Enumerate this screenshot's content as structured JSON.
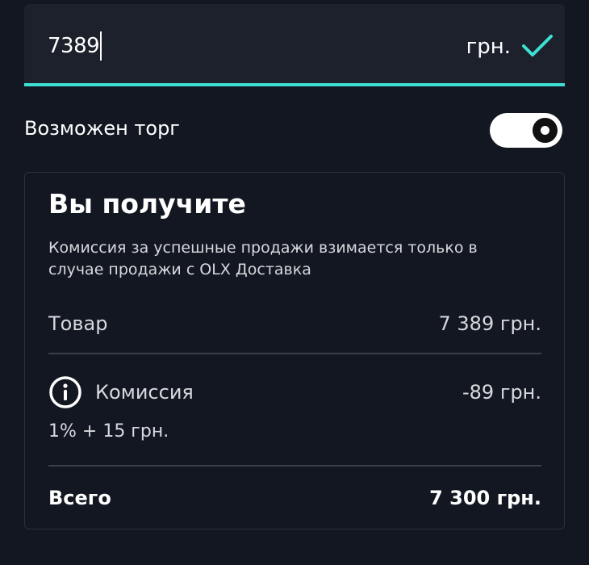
{
  "price": {
    "value": "7389",
    "currency": "грн."
  },
  "negotiable": {
    "label": "Возможен торг",
    "enabled": true
  },
  "summary": {
    "title": "Вы получите",
    "description": "Комиссия за успешные продажи взимается только в случае продажи с OLX Доставка",
    "item_label": "Товар",
    "item_value": "7 389 грн.",
    "fee_label": "Комиссия",
    "fee_value": "-89 грн.",
    "fee_formula": "1% + 15 грн.",
    "total_label": "Всего",
    "total_value": "7 300 грн."
  },
  "colors": {
    "background": "#121721",
    "accent": "#3ee0d4",
    "field": "#1c212b"
  },
  "icons": {
    "check": "check-icon",
    "info": "info-icon"
  }
}
